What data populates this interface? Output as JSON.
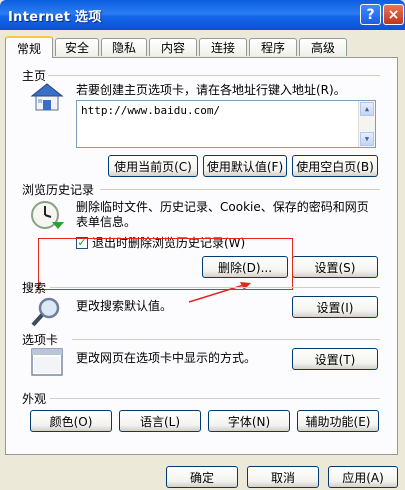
{
  "window": {
    "title": "Internet 选项",
    "help_label": "?",
    "close_label": "×"
  },
  "tabs": [
    {
      "label": "常规",
      "active": true
    },
    {
      "label": "安全"
    },
    {
      "label": "隐私"
    },
    {
      "label": "内容"
    },
    {
      "label": "连接"
    },
    {
      "label": "程序"
    },
    {
      "label": "高级"
    }
  ],
  "homepage": {
    "section_label": "主页",
    "description": "若要创建主页选项卡，请在各地址行键入地址(R)。",
    "address_value": "http://www.baidu.com/",
    "buttons": {
      "use_current": "使用当前页(C)",
      "use_default": "使用默认值(F)",
      "use_blank": "使用空白页(B)"
    }
  },
  "history": {
    "section_label": "浏览历史记录",
    "description_line1": "删除临时文件、历史记录、Cookie、保存的密码和网页",
    "description_line2": "表单信息。",
    "checkbox_label": "退出时删除浏览历史记录(W)",
    "checkbox_checked": true,
    "delete_label": "删除(D)...",
    "settings_label": "设置(S)"
  },
  "search": {
    "section_label": "搜索",
    "description": "更改搜索默认值。",
    "settings_label": "设置(I)"
  },
  "tabs_section": {
    "section_label": "选项卡",
    "description": "更改网页在选项卡中显示的方式。",
    "settings_label": "设置(T)"
  },
  "appearance": {
    "section_label": "外观",
    "colors_label": "颜色(O)",
    "languages_label": "语言(L)",
    "fonts_label": "字体(N)",
    "accessibility_label": "辅助功能(E)"
  },
  "footer": {
    "ok_label": "确定",
    "cancel_label": "取消",
    "apply_label": "应用(A)"
  },
  "colors": {
    "annotation_red": "#e0281c",
    "titlebar_blue": "#0a5fe0"
  }
}
